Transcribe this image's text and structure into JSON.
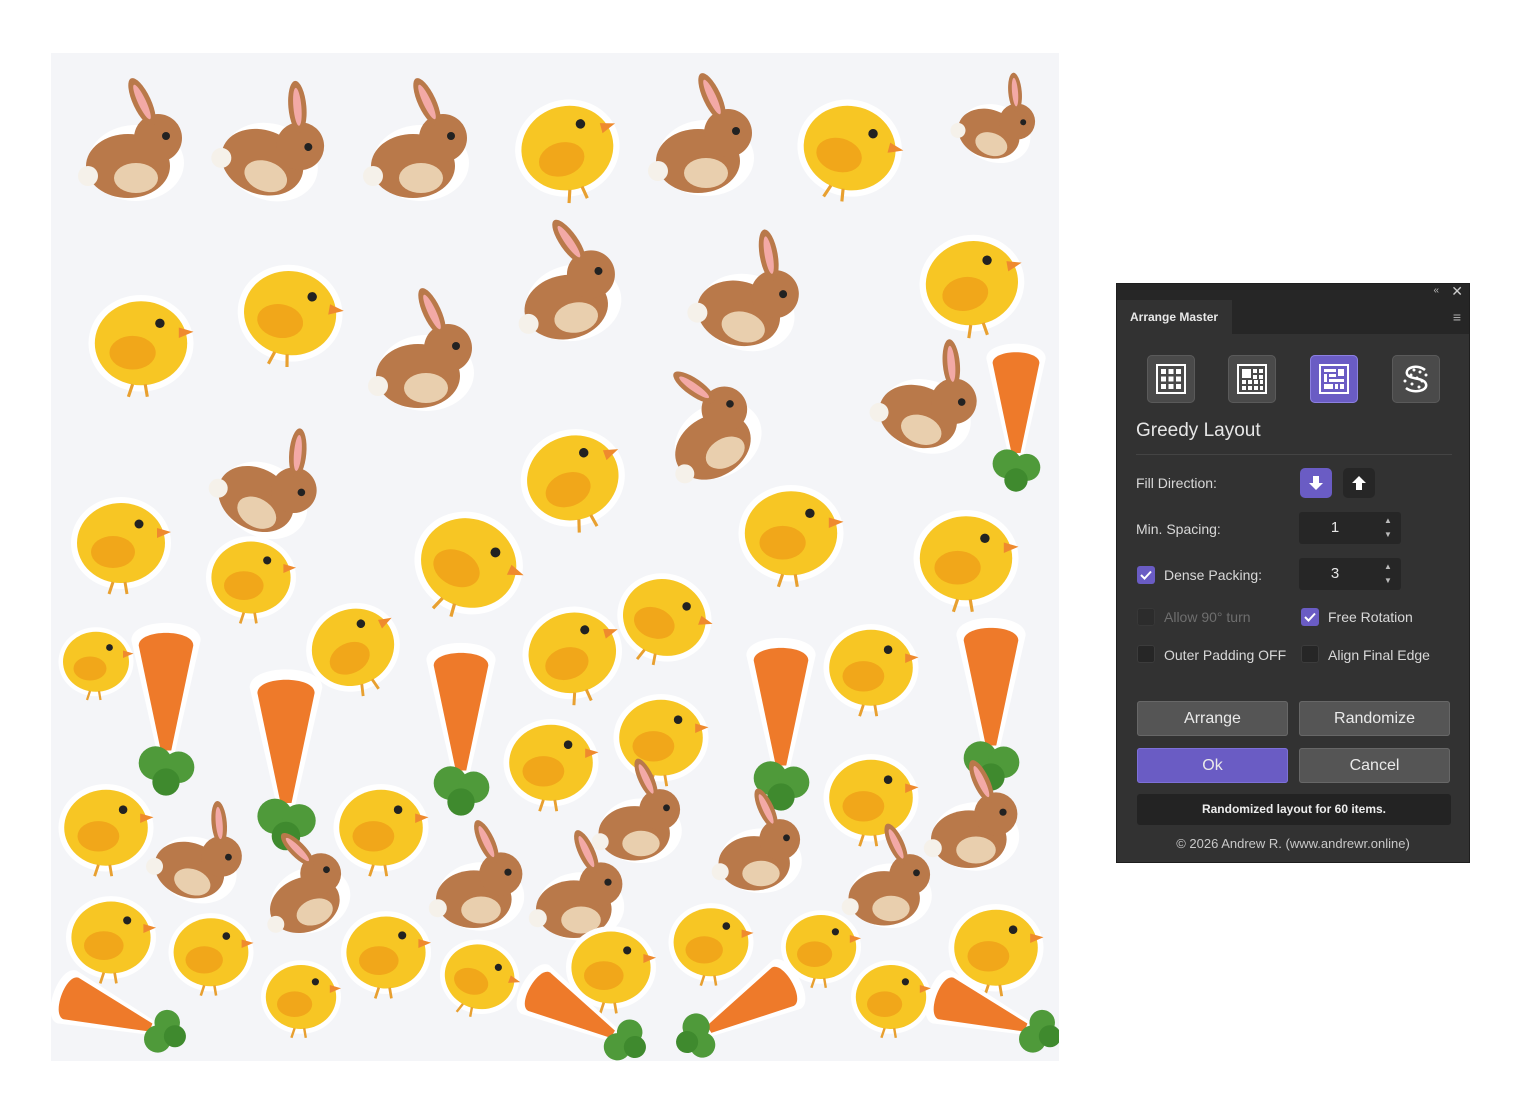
{
  "artboard": {
    "background": "#f4f5f8",
    "item_count": 60,
    "item_types": [
      "bunny",
      "chick",
      "carrot"
    ],
    "colors": {
      "bunny": "#b9794a",
      "chick": "#f7c624",
      "carrot": "#ee7a2a",
      "leaf": "#4f9a3a"
    }
  },
  "panel": {
    "tab_label": "Arrange Master",
    "collapse_glyph": "«",
    "close_glyph": "✕",
    "menu_glyph": "≡",
    "modes": [
      {
        "name": "grid-layout",
        "active": false
      },
      {
        "name": "grid-fit-layout",
        "active": false
      },
      {
        "name": "greedy-layout",
        "active": true
      },
      {
        "name": "scatter-layout",
        "active": false
      }
    ],
    "section_title": "Greedy Layout",
    "fill_direction": {
      "label": "Fill Direction:",
      "selected": "down"
    },
    "min_spacing": {
      "label": "Min. Spacing:",
      "value": "1"
    },
    "dense_packing": {
      "label": "Dense Packing:",
      "checked": true,
      "value": "3"
    },
    "allow_90_turn": {
      "label": "Allow 90° turn",
      "checked": false,
      "disabled": true
    },
    "free_rotation": {
      "label": "Free Rotation",
      "checked": true
    },
    "outer_padding_off": {
      "label": "Outer Padding OFF",
      "checked": false
    },
    "align_final_edge": {
      "label": "Align Final Edge",
      "checked": false
    },
    "buttons": {
      "arrange": "Arrange",
      "randomize": "Randomize",
      "ok": "Ok",
      "cancel": "Cancel"
    },
    "status": "Randomized layout for 60 items.",
    "copyright": "© 2026 Andrew R. (www.andrewr.online)",
    "accent_color": "#6a5cc4"
  }
}
